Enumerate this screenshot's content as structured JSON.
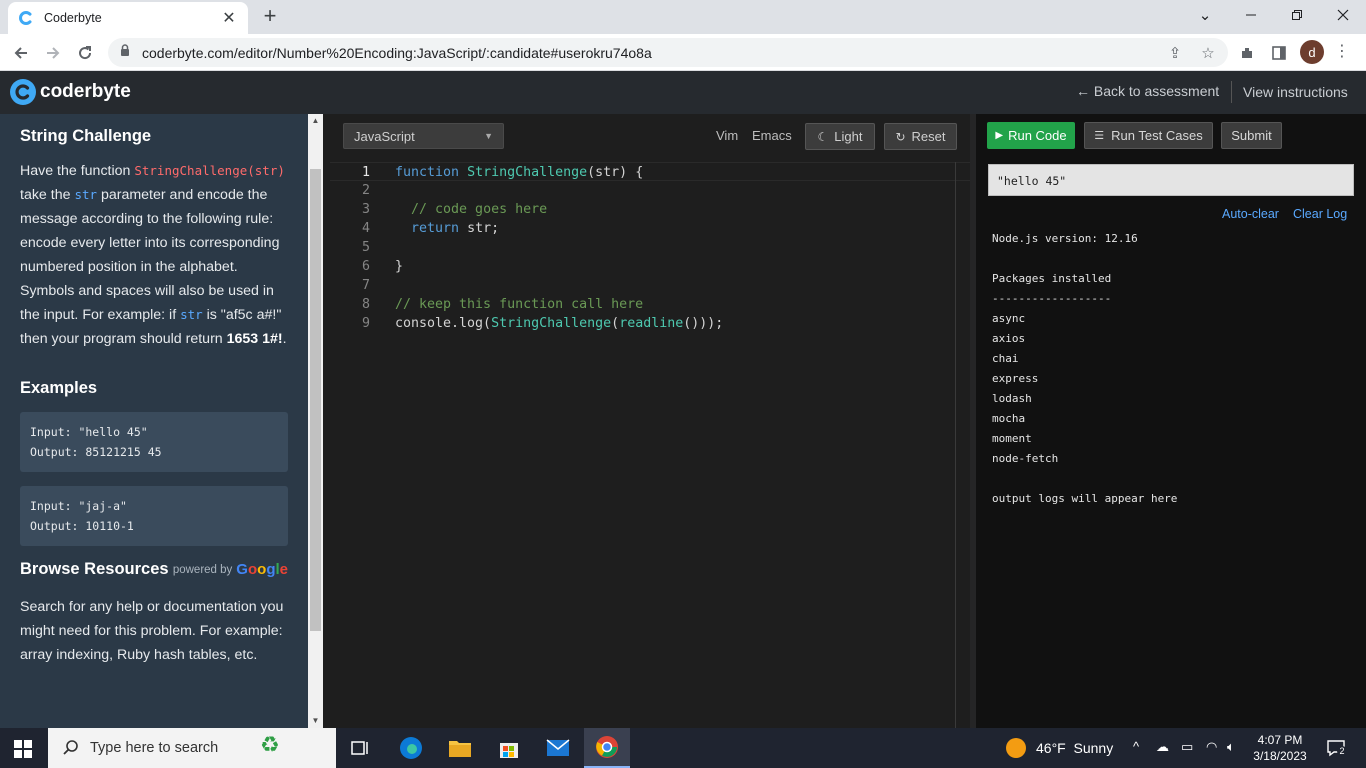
{
  "browser": {
    "tab_title": "Coderbyte",
    "url": "coderbyte.com/editor/Number%20Encoding:JavaScript/:candidate#userokru74o8a",
    "profile_initial": "d"
  },
  "header": {
    "brand": "coderbyte",
    "back_link": "← Back to assessment",
    "view_instructions": "View instructions"
  },
  "challenge": {
    "title": "String Challenge",
    "desc_1": "Have the function ",
    "func_name": "StringChallenge(str)",
    "desc_2": " take the ",
    "param": "str",
    "desc_3": " parameter and encode the message according to the following rule: encode every letter into its corresponding numbered position in the alphabet. Symbols and spaces will also be used in the input. For example: if ",
    "param_2": "str",
    "desc_4": " is \"af5c a#!\" then your program should return ",
    "answer": "1653 1#!",
    "desc_5": ".",
    "examples_title": "Examples",
    "examples": [
      {
        "input": "Input: \"hello 45\"",
        "output": "Output: 85121215 45"
      },
      {
        "input": "Input: \"jaj-a\"",
        "output": "Output: 10110-1"
      }
    ],
    "browse_title": "Browse Resources",
    "powered_by": "powered by",
    "google": "Google",
    "browse_text": "Search for any help or documentation you might need for this problem. For example: array indexing, Ruby hash tables, etc."
  },
  "editor": {
    "language": "JavaScript",
    "vim": "Vim",
    "emacs": "Emacs",
    "light": "Light",
    "reset": "Reset",
    "line_numbers": [
      "1",
      "2",
      "3",
      "4",
      "5",
      "6",
      "7",
      "8",
      "9"
    ]
  },
  "right": {
    "run_code": "Run Code",
    "run_tests": "Run Test Cases",
    "submit": "Submit",
    "input_value": "\"hello 45\"",
    "auto_clear": "Auto-clear",
    "clear_log": "Clear Log",
    "console": [
      "Node.js version: 12.16",
      "",
      "Packages installed",
      "------------------",
      "async",
      "axios",
      "chai",
      "express",
      "lodash",
      "mocha",
      "moment",
      "node-fetch",
      "",
      "output logs will appear here"
    ]
  },
  "taskbar": {
    "search_placeholder": "Type here to search",
    "weather": "46°F  Sunny",
    "time": "4:07 PM",
    "date": "3/18/2023",
    "notifications": "2"
  }
}
